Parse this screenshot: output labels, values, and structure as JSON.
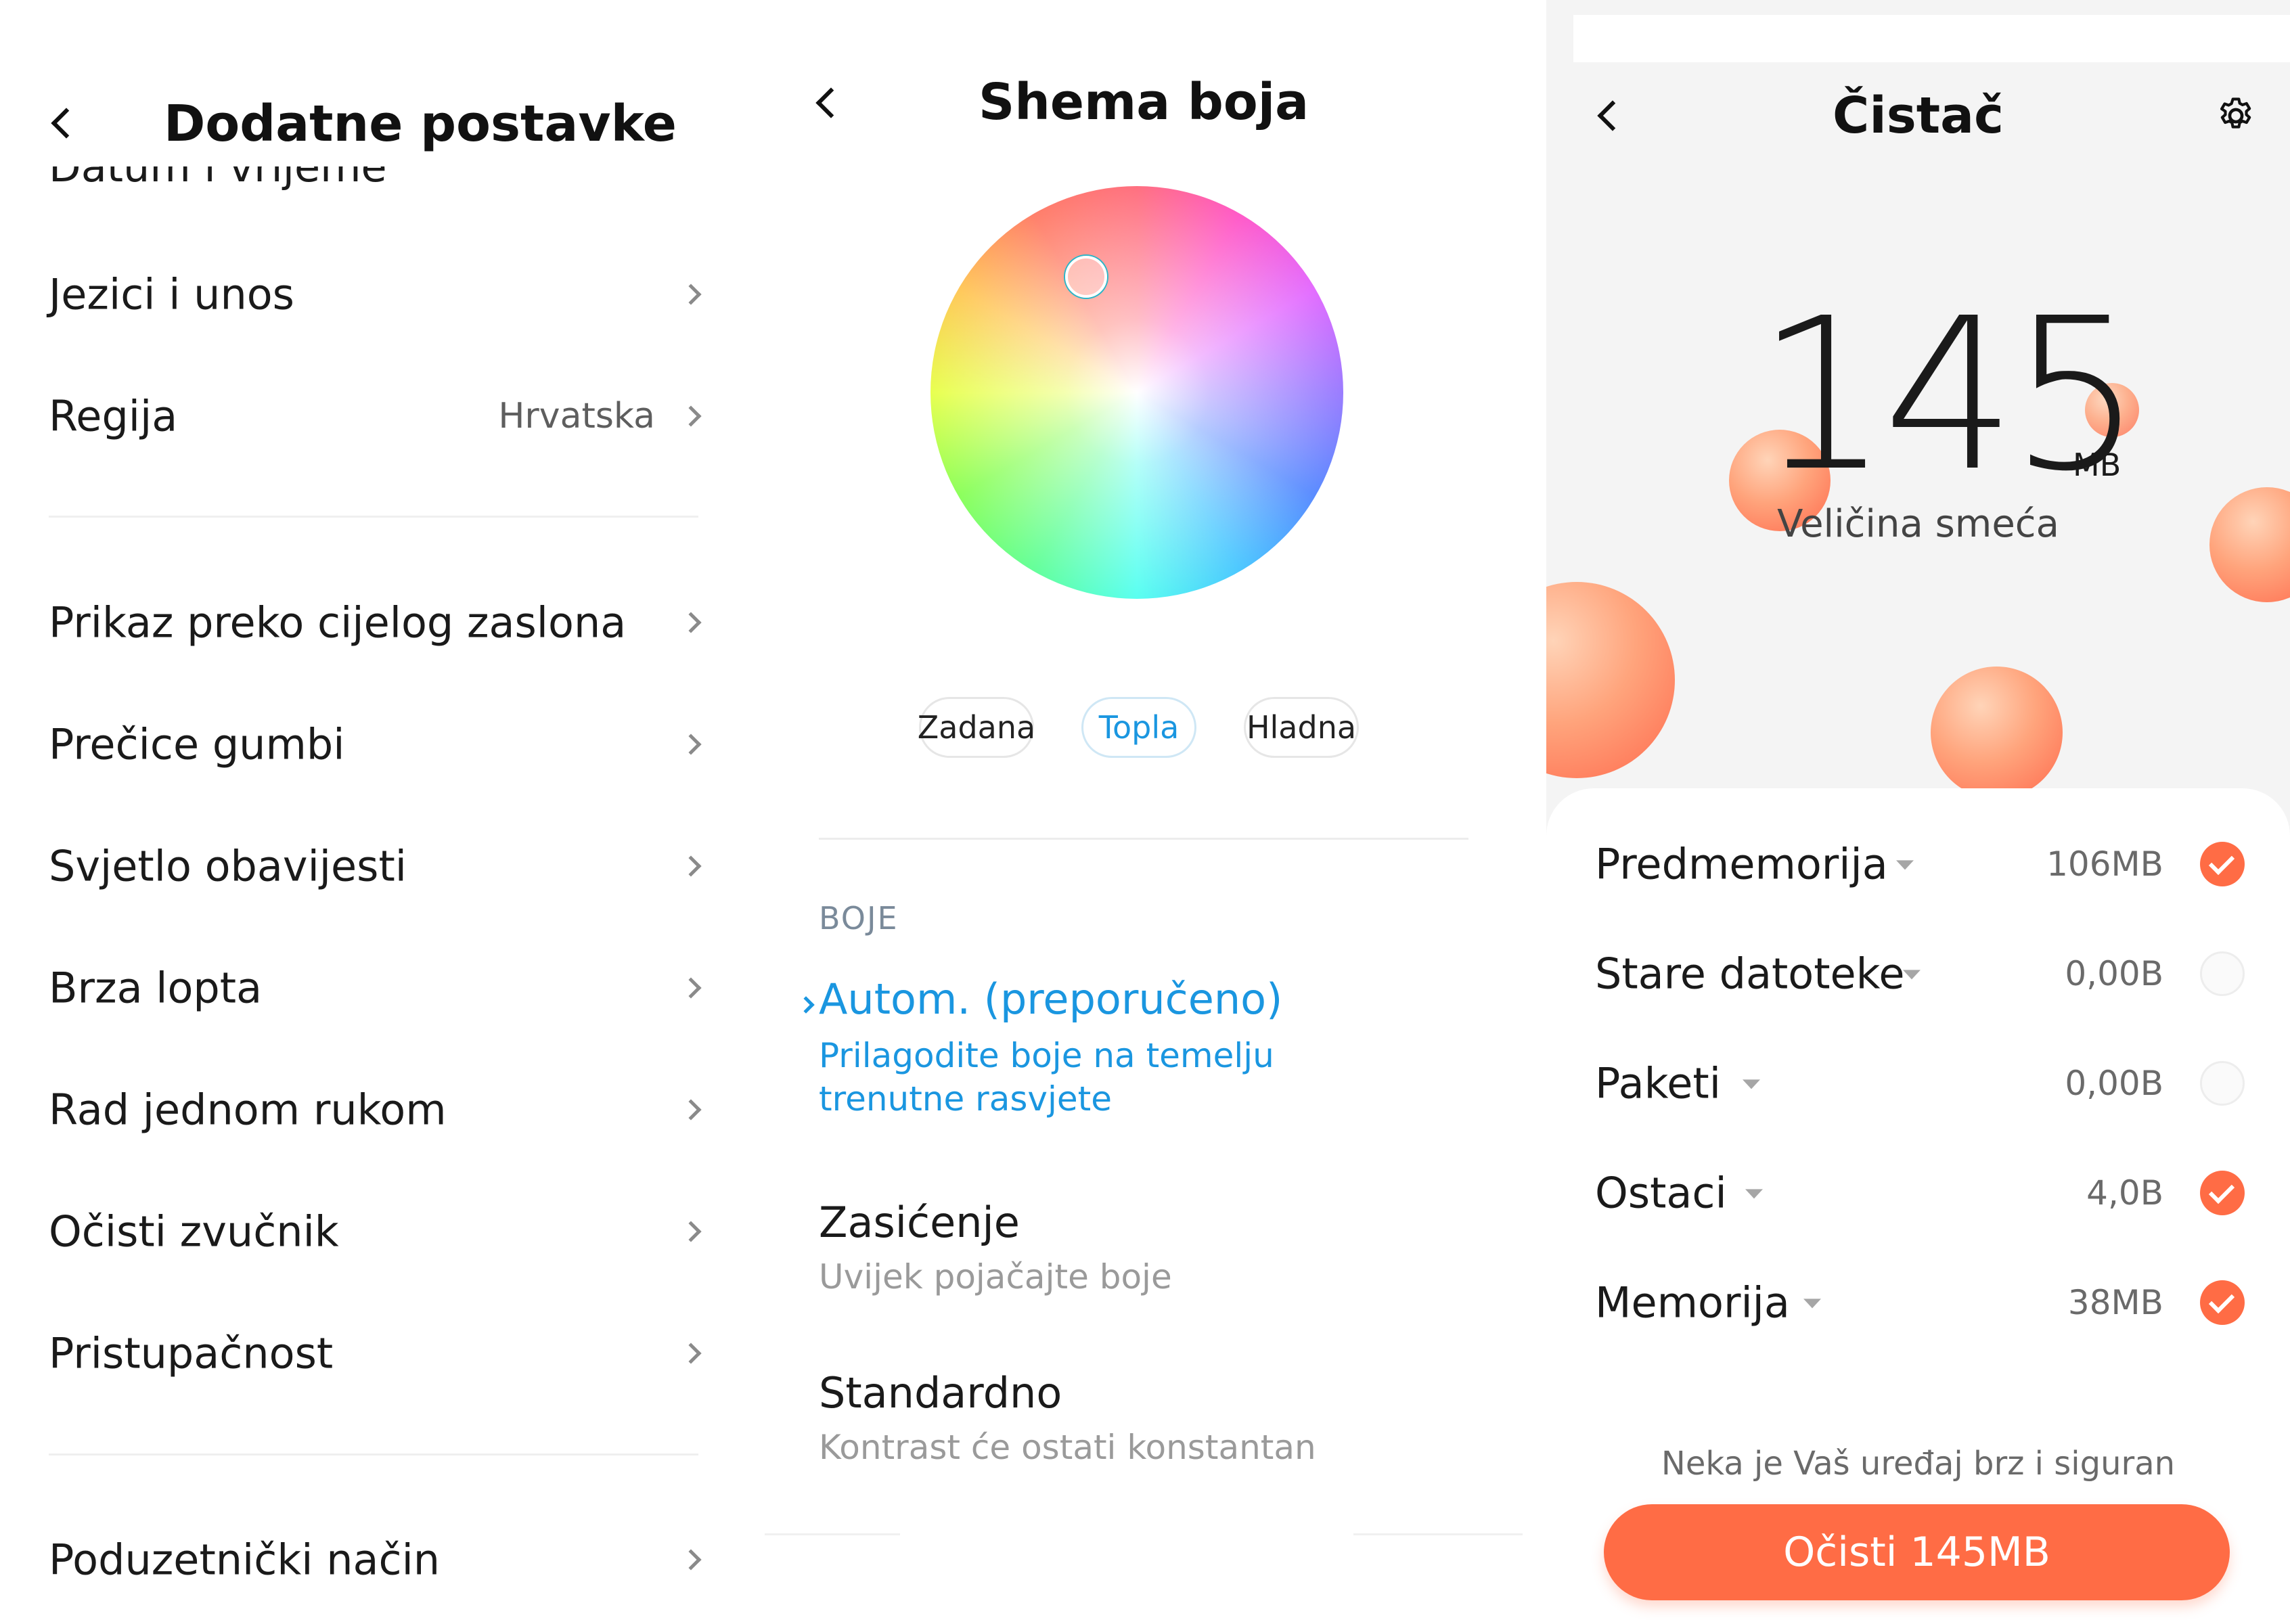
{
  "panel1": {
    "title": "Dodatne postavke",
    "partial_item": "Datum i vrijeme",
    "items": [
      {
        "label": "Jezici i unos",
        "value": ""
      },
      {
        "label": "Regija",
        "value": "Hrvatska"
      },
      {
        "label": "Prikaz preko cijelog zaslona",
        "value": ""
      },
      {
        "label": "Prečice gumbi",
        "value": ""
      },
      {
        "label": "Svjetlo obavijesti",
        "value": ""
      },
      {
        "label": "Brza lopta",
        "value": ""
      },
      {
        "label": "Rad jednom rukom",
        "value": ""
      },
      {
        "label": "Očisti zvučnik",
        "value": ""
      },
      {
        "label": "Pristupačnost",
        "value": ""
      },
      {
        "label": "Poduzetnički način",
        "value": ""
      }
    ]
  },
  "panel2": {
    "title": "Shema boja",
    "chips": [
      {
        "label": "Zadana",
        "selected": false
      },
      {
        "label": "Topla",
        "selected": true
      },
      {
        "label": "Hladna",
        "selected": false
      }
    ],
    "section_header": "BOJE",
    "options": [
      {
        "title": "Autom. (preporučeno)",
        "subtitle": "Prilagodite boje na temelju trenutne rasvjete",
        "selected": true
      },
      {
        "title": "Zasićenje",
        "subtitle": "Uvijek pojačajte boje",
        "selected": false
      },
      {
        "title": "Standardno",
        "subtitle": "Kontrast će ostati konstantan",
        "selected": false
      }
    ]
  },
  "panel3": {
    "title": "Čistač",
    "junk_size": "145",
    "junk_unit": "MB",
    "junk_label": "Veličina smeća",
    "items": [
      {
        "label": "Predmemorija",
        "size": "106MB",
        "checked": true
      },
      {
        "label": "Stare datoteke",
        "size": "0,00B",
        "checked": false
      },
      {
        "label": "Paketi",
        "size": "0,00B",
        "checked": false
      },
      {
        "label": "Ostaci",
        "size": "4,0B",
        "checked": true
      },
      {
        "label": "Memorija",
        "size": "38MB",
        "checked": true
      }
    ],
    "footer_note": "Neka je Vaš uređaj brz i siguran",
    "clean_button": "Očisti 145MB"
  },
  "colors": {
    "accent_blue": "#1a96e0",
    "accent_orange": "#ff6c45"
  },
  "icons": [
    "back-icon",
    "chevron-right-icon",
    "settings-icon",
    "dropdown-triangle-icon",
    "check-icon"
  ]
}
